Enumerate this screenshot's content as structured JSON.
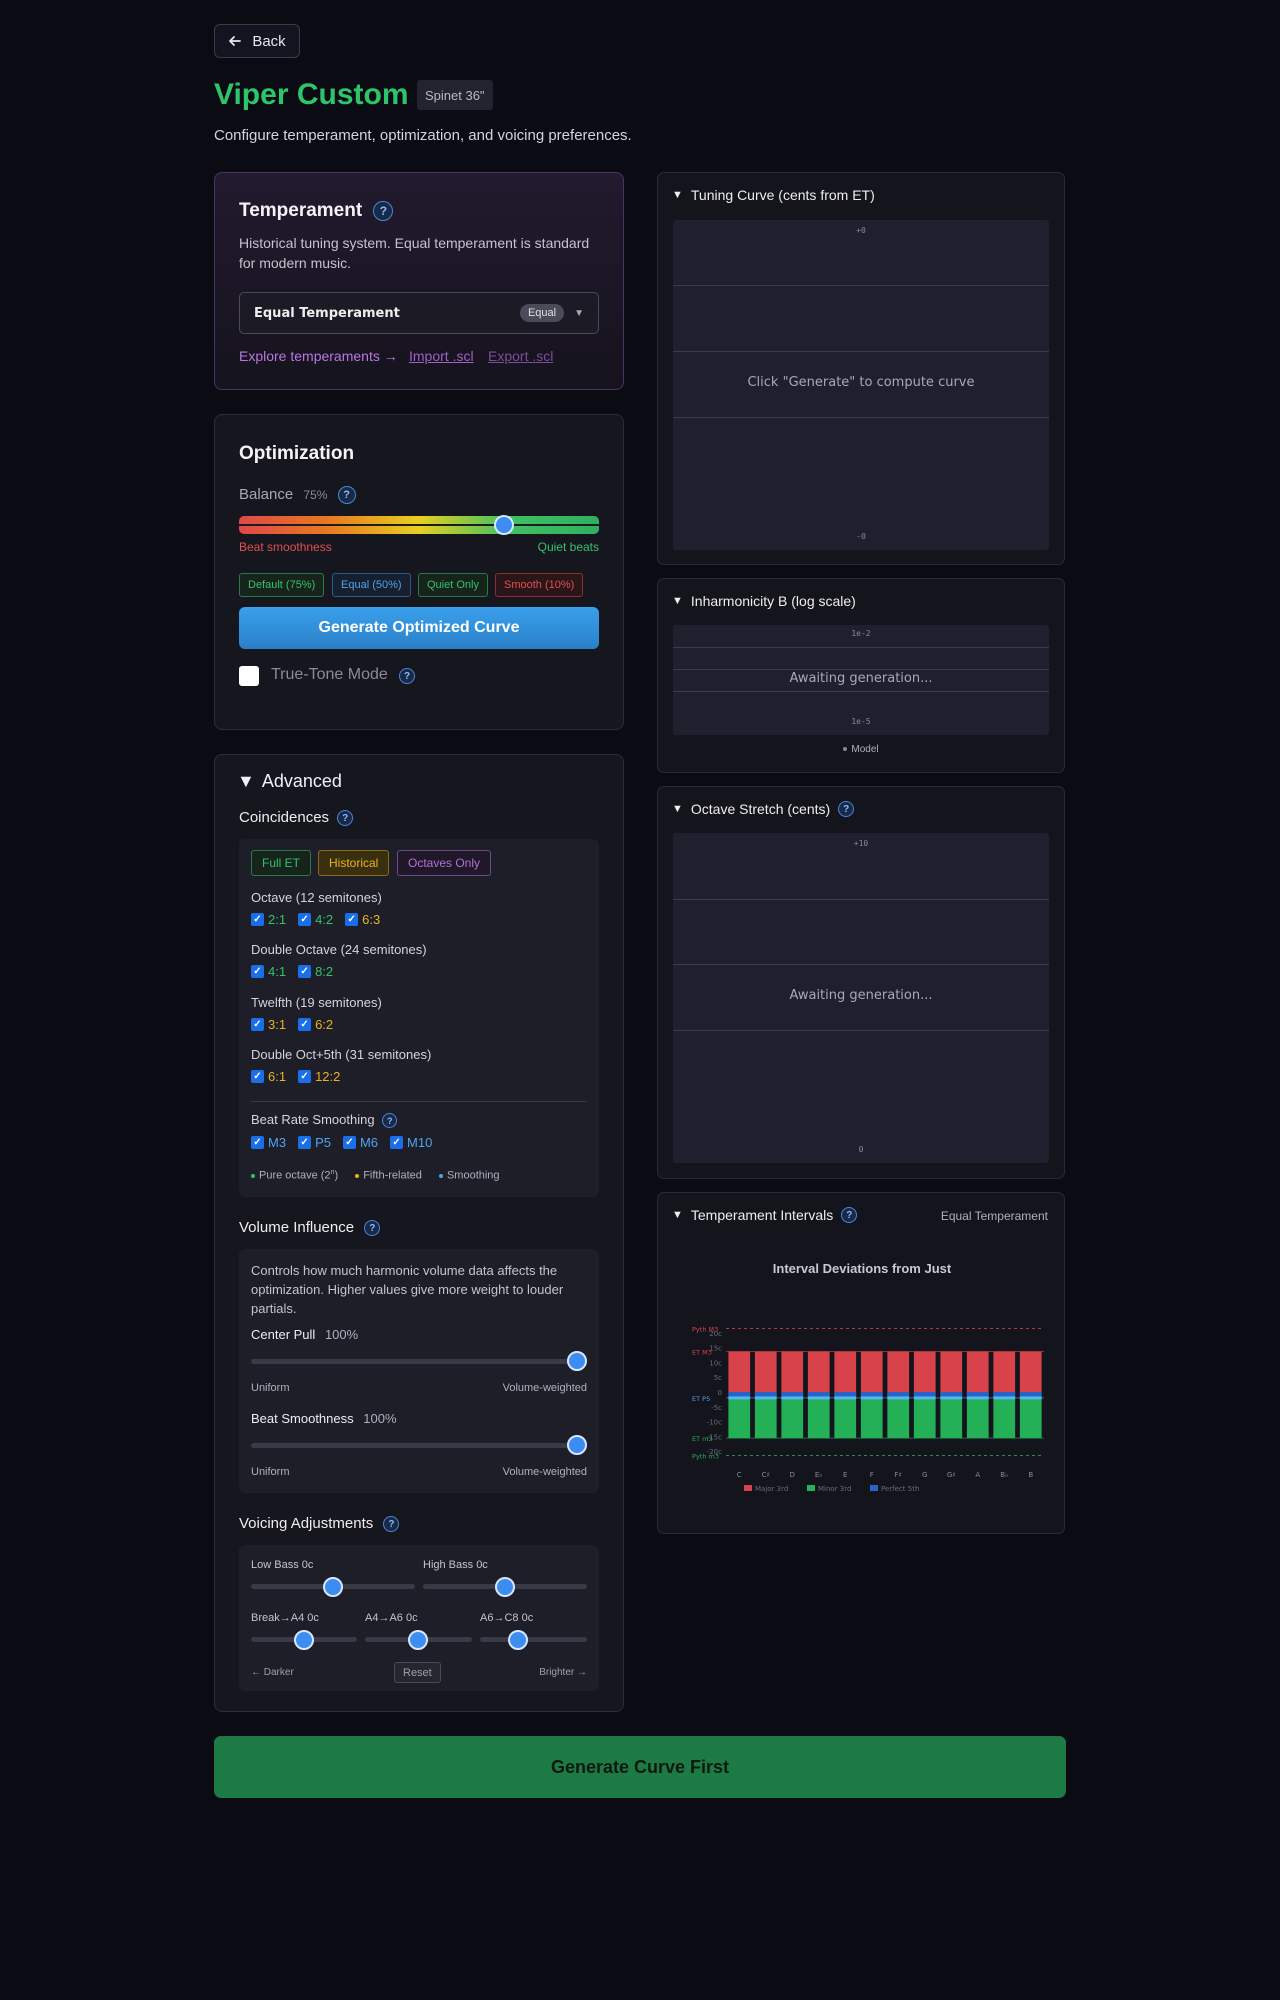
{
  "header": {
    "back_label": "Back",
    "title": "Viper Custom",
    "piano_badge": "Spinet 36\"",
    "subtitle": "Configure temperament, optimization, and voicing preferences."
  },
  "temperament": {
    "title": "Temperament",
    "help": "?",
    "description": "Historical tuning system. Equal temperament is standard for modern music.",
    "selected": "Equal Temperament",
    "selected_badge": "Equal",
    "caret": "▼",
    "explore_link": "Explore temperaments →",
    "import_link": "Import .scl",
    "export_link": "Export .scl"
  },
  "optimization": {
    "title": "Optimization",
    "balance_label": "Balance",
    "balance_value": "75%",
    "balance_fraction": 0.75,
    "help": "?",
    "left_label": "Beat smoothness",
    "right_label": "Quiet beats",
    "presets": [
      {
        "label": "Default (75%)",
        "color": "#34c26a"
      },
      {
        "label": "Equal (50%)",
        "color": "#4fa4f0"
      },
      {
        "label": "Quiet Only",
        "color": "#34c26a"
      },
      {
        "label": "Smooth (10%)",
        "color": "#e05050"
      }
    ],
    "generate_label": "Generate Optimized Curve",
    "truetone_label": "True-Tone Mode"
  },
  "advanced": {
    "title": "Advanced",
    "coincidences_title": "Coincidences",
    "help": "?",
    "chips": [
      {
        "label": "Full ET",
        "color": "#34c26a"
      },
      {
        "label": "Historical",
        "color": "#e8b420"
      },
      {
        "label": "Octaves Only",
        "color": "#b070d8"
      }
    ],
    "groups": [
      {
        "label": "Octave (12 semitones)",
        "items": [
          {
            "t": "2:1",
            "c": "green"
          },
          {
            "t": "4:2",
            "c": "green"
          },
          {
            "t": "6:3",
            "c": "yellow"
          }
        ]
      },
      {
        "label": "Double Octave (24 semitones)",
        "items": [
          {
            "t": "4:1",
            "c": "green"
          },
          {
            "t": "8:2",
            "c": "green"
          }
        ]
      },
      {
        "label": "Twelfth (19 semitones)",
        "items": [
          {
            "t": "3:1",
            "c": "yellow"
          },
          {
            "t": "6:2",
            "c": "yellow"
          }
        ]
      },
      {
        "label": "Double Oct+5th (31 semitones)",
        "items": [
          {
            "t": "6:1",
            "c": "yellow"
          },
          {
            "t": "12:2",
            "c": "yellow"
          }
        ]
      }
    ],
    "beat_title": "Beat Rate Smoothing",
    "beat_items": [
      "M3",
      "P5",
      "M6",
      "M10"
    ],
    "legend_pure": "Pure octave (2",
    "legend_pure_sup": "n",
    "legend_pure_end": ")",
    "legend_fifth": "Fifth-related",
    "legend_smooth": "Smoothing",
    "volume_title": "Volume Influence",
    "volume_desc": "Controls how much harmonic volume data affects the optimization. Higher values give more weight to louder partials.",
    "center_pull_label": "Center Pull",
    "center_pull_value": "100%",
    "beat_smooth_label": "Beat Smoothness",
    "beat_smooth_value": "100%",
    "uniform": "Uniform",
    "weighted": "Volume-weighted",
    "voicing_title": "Voicing Adjustments",
    "low_bass": "Low Bass 0c",
    "high_bass": "High Bass 0c",
    "break_a4": "Break→A4 0c",
    "a4_a6": "A4→A6 0c",
    "a6_c8": "A6→C8 0c",
    "darker": "← Darker",
    "reset": "Reset",
    "brighter": "Brighter →"
  },
  "panels": {
    "tuning": {
      "title": "Tuning Curve (cents from ET)",
      "top_tick": "+0",
      "bottom_tick": "-0",
      "message": "Click \"Generate\" to compute curve"
    },
    "inharm": {
      "title": "Inharmonicity B (log scale)",
      "top_tick": "1e-2",
      "bottom_tick": "1e-5",
      "message": "Awaiting generation...",
      "legend": "Model"
    },
    "octave": {
      "title": "Octave Stretch (cents)",
      "top_tick": "+10",
      "bottom_tick": "0",
      "message": "Awaiting generation..."
    },
    "intervals": {
      "title": "Temperament Intervals",
      "right_label": "Equal Temperament",
      "chart_title": "Interval Deviations from Just"
    }
  },
  "chart_data": {
    "type": "bar",
    "title": "Interval Deviations from Just",
    "categories": [
      "C",
      "C♯",
      "D",
      "E♭",
      "E",
      "F",
      "F♯",
      "G",
      "G♯",
      "A",
      "B♭",
      "B"
    ],
    "series": [
      {
        "name": "Major 3rd",
        "values": [
          13.7,
          13.7,
          13.7,
          13.7,
          13.7,
          13.7,
          13.7,
          13.7,
          13.7,
          13.7,
          13.7,
          13.7
        ],
        "color": "#d8424a"
      },
      {
        "name": "Minor 3rd",
        "values": [
          -15.6,
          -15.6,
          -15.6,
          -15.6,
          -15.6,
          -15.6,
          -15.6,
          -15.6,
          -15.6,
          -15.6,
          -15.6,
          -15.6
        ],
        "color": "#24b057"
      },
      {
        "name": "Perfect 5th",
        "values": [
          -2,
          -2,
          -2,
          -2,
          -2,
          -2,
          -2,
          -2,
          -2,
          -2,
          -2,
          -2
        ],
        "color": "#2a62c8"
      }
    ],
    "ytick_labels": [
      "20c",
      "15c",
      "10c",
      "5c",
      "0",
      "-5c",
      "-10c",
      "-15c",
      "-20c"
    ],
    "ref_lines": [
      {
        "label": "Pyth M3",
        "value": 21.5,
        "color": "#d8424a"
      },
      {
        "label": "ET M3",
        "value": 13.7,
        "color": "#d8424a"
      },
      {
        "label": "ET P5",
        "value": -2,
        "color": "#4fa4f0"
      },
      {
        "label": "ET m3",
        "value": -15.6,
        "color": "#24b057"
      },
      {
        "label": "Pyth m3",
        "value": -21.5,
        "color": "#24b057"
      }
    ],
    "ylim": [
      -22,
      22
    ],
    "legend": "bottom"
  },
  "footer": {
    "button_label": "Generate Curve First"
  }
}
